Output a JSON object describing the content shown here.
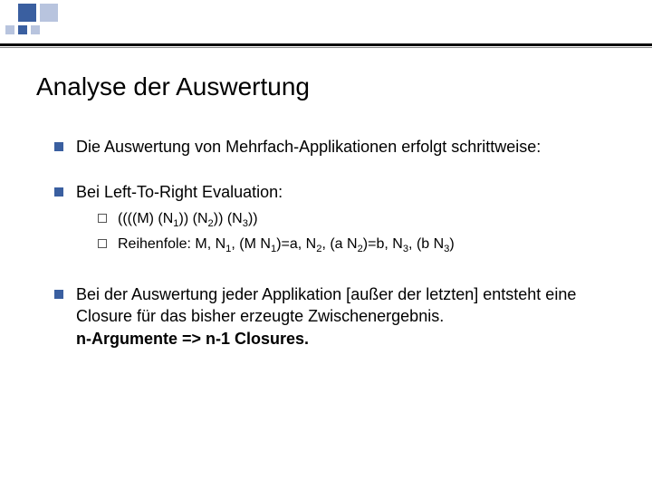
{
  "title": "Analyse der Auswertung",
  "bullets": {
    "b1": "Die Auswertung von Mehrfach-Applikationen erfolgt schrittweise:",
    "b2": "Bei Left-To-Right Evaluation:",
    "b2_sub": {
      "s1_a": "((((M) (N",
      "s1_b": ")) (N",
      "s1_c": ")) (N",
      "s1_d": "))",
      "s2_a": "Reihenfole: M, N",
      "s2_b": ", (M N",
      "s2_c": ")=a, N",
      "s2_d": ", (a N",
      "s2_e": ")=b, N",
      "s2_f": ", (b N",
      "s2_g": ")"
    },
    "b3_a": "Bei der Auswertung jeder Applikation [außer der letzten] entsteht eine Closure für das bisher erzeugte Zwischenergebnis.",
    "b3_b": "n-Argumente => n-1 Closures."
  },
  "subs": {
    "n1": "1",
    "n2": "2",
    "n3": "3"
  }
}
